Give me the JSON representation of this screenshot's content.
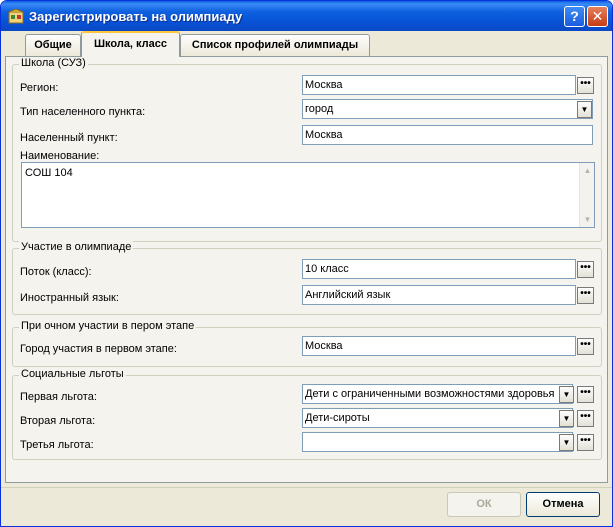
{
  "window": {
    "title": "Зарегистрировать на олимпиаду",
    "help_label": "?",
    "close_label": "✕"
  },
  "tabs": [
    {
      "label": "Общие",
      "active": false
    },
    {
      "label": "Школа, класс",
      "active": true
    },
    {
      "label": "Список профилей олимпиады",
      "active": false
    }
  ],
  "school": {
    "legend": "Школа (СУЗ)",
    "region_label": "Регион:",
    "region_value": "Москва",
    "settlement_type_label": "Тип населенного пункта:",
    "settlement_type_value": "город",
    "settlement_label": "Населенный пункт:",
    "settlement_value": "Москва",
    "name_label": "Наименование:",
    "name_value": "СОШ 104"
  },
  "participation": {
    "legend": "Участие в олимпиаде",
    "stream_label": "Поток (класс):",
    "stream_value": "10 класс",
    "language_label": "Иностранный язык:",
    "language_value": "Английский язык"
  },
  "first_stage": {
    "legend": "При очном участии в пером этапе",
    "city_label": "Город участия в первом этапе:",
    "city_value": "Москва"
  },
  "benefits": {
    "legend": "Социальные льготы",
    "first_label": "Первая льгота:",
    "first_value": "Дети с ограниченными возможностями здоровья",
    "second_label": "Вторая льгота:",
    "second_value": "Дети-сироты",
    "third_label": "Третья льгота:",
    "third_value": ""
  },
  "buttons": {
    "ok_label": "ОК",
    "cancel_label": "Отмена",
    "ok_enabled": false
  },
  "glyphs": {
    "ellipsis": "•••",
    "dropdown": "▼",
    "up": "▲",
    "down": "▼"
  },
  "colors": {
    "titlebar": "#0752d6",
    "tab_highlight": "#ffc83c",
    "panel": "#f4f3ee",
    "border": "#7f9db9"
  }
}
